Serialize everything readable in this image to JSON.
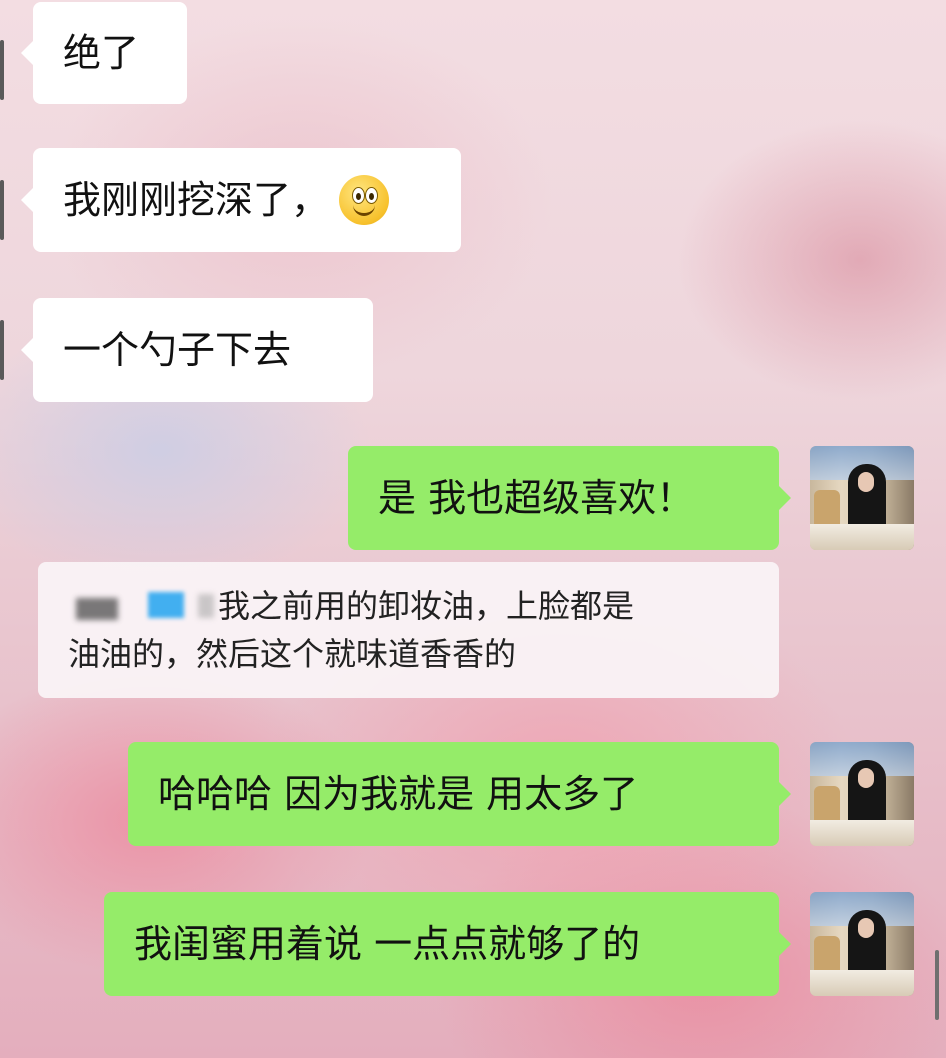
{
  "messages": [
    {
      "side": "left",
      "text": "绝了"
    },
    {
      "side": "left",
      "text": "我刚刚挖深了，",
      "emoji": "smiley-emoji"
    },
    {
      "side": "left",
      "text": "一个勺子下去"
    },
    {
      "side": "right",
      "text": "是 我也超级喜欢！"
    },
    {
      "side": "right",
      "text": "哈哈哈 因为我就是 用太多了"
    },
    {
      "side": "right",
      "text": "我闺蜜用着说 一点点就够了的"
    }
  ],
  "quote": {
    "line1": "我之前用的卸妆油，上脸都是",
    "line2": "油油的，然后这个就味道香香的"
  },
  "colors": {
    "left_bubble": "#ffffff",
    "right_bubble": "#95ec69",
    "text": "#111111"
  }
}
